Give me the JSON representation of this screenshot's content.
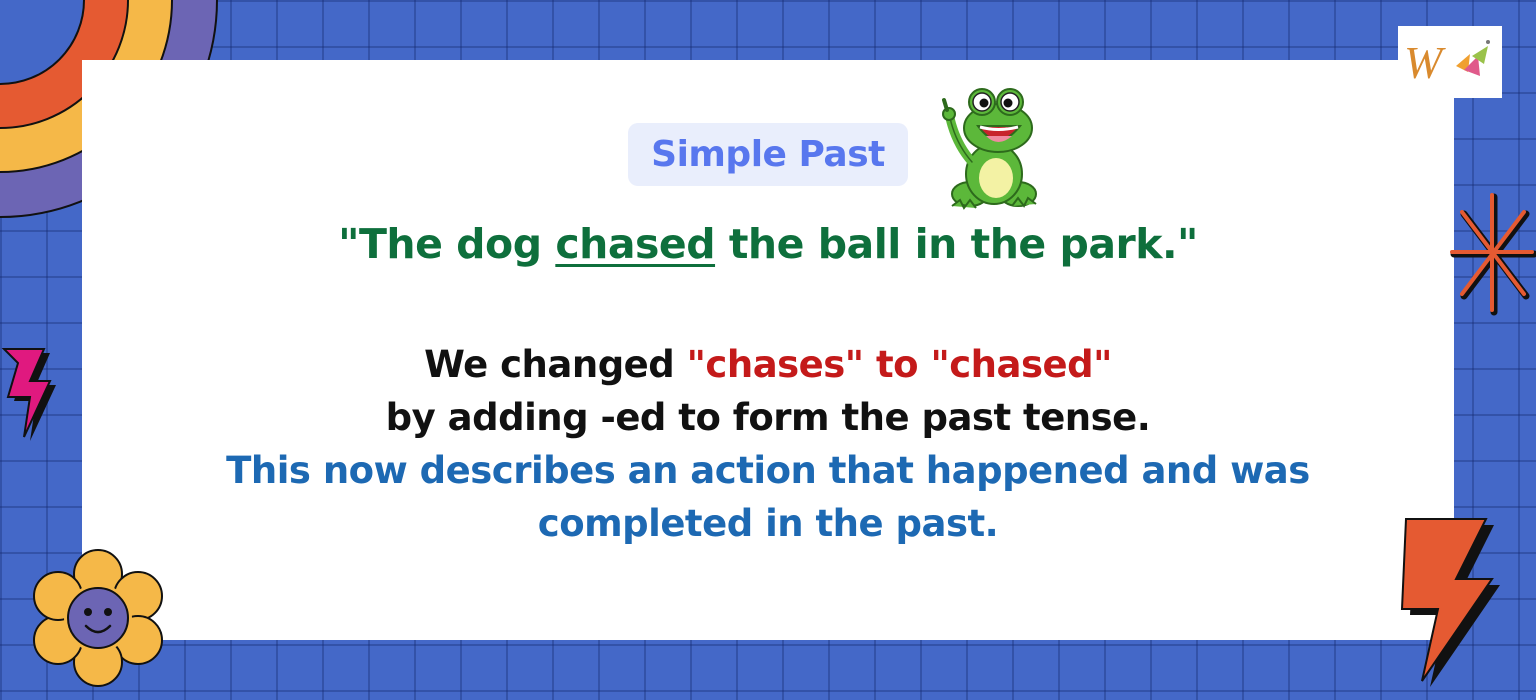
{
  "badge": {
    "label": "Simple Past"
  },
  "sentence": {
    "before": "\"The dog ",
    "verb": "chased",
    "after": " the ball in the park.\""
  },
  "explanation": {
    "line1_prefix": "We changed ",
    "line1_highlight": "\"chases\" to \"chased\"",
    "line2": "by adding -ed to form the past tense.",
    "line3": "This now describes an action that happened and was",
    "line4": "completed in the past."
  },
  "colors": {
    "background": "#4468c8",
    "card": "#ffffff",
    "badge_text": "#5877ee",
    "sentence": "#0e6f3c",
    "highlight": "#c41a1a",
    "explanation_blue": "#1d69b3"
  },
  "icons": {
    "logo": "w-brand-logo",
    "frog": "frog-mascot-icon",
    "rainbow": "rainbow-decoration",
    "flower": "smiling-flower-icon",
    "bolt_left": "lightning-bolt-icon",
    "bolt_right": "lightning-bolt-icon",
    "asterisk": "asterisk-star-icon"
  }
}
